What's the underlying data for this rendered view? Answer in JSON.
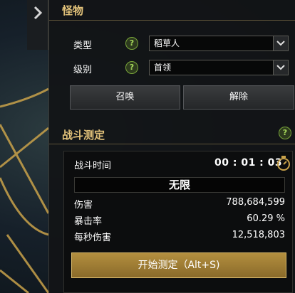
{
  "monster": {
    "title": "怪物",
    "type_label": "类型",
    "type_value": "稻草人",
    "level_label": "级别",
    "level_value": "首领",
    "summon_label": "召唤",
    "dismiss_label": "解除"
  },
  "combat": {
    "title": "战斗测定",
    "time_label": "战斗时间",
    "time_value": "00 : 01 : 03",
    "mode_value": "无限",
    "damage_label": "伤害",
    "damage_value": "788,684,599",
    "crit_label": "暴击率",
    "crit_value": "60.29 %",
    "dps_label": "每秒伤害",
    "dps_value": "12,518,803",
    "start_label": "开始测定（Alt+S)"
  },
  "help_glyph": "?",
  "colors": {
    "title_gold": "#e2c27a",
    "start_button": "#a07e35",
    "help_green": "#7aa63a"
  }
}
